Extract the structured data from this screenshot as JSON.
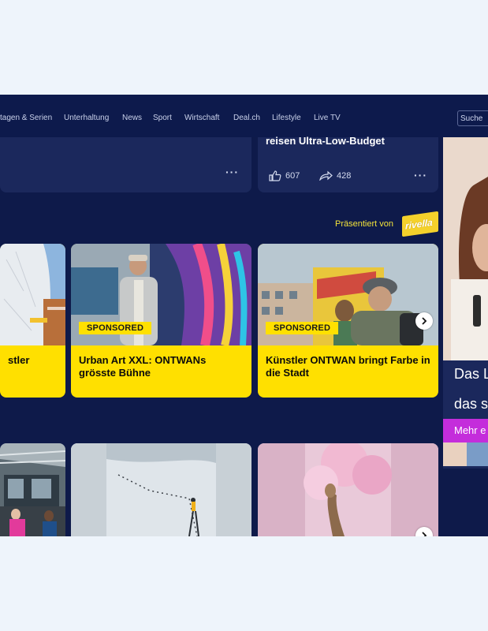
{
  "nav": {
    "items": [
      "tagen & Serien",
      "Unterhaltung",
      "News",
      "Sport",
      "Wirtschaft",
      "Deal.ch",
      "Lifestyle",
      "Live TV"
    ],
    "search_placeholder": "Suche"
  },
  "top_cards": [
    {
      "title": "",
      "more_label": "···"
    },
    {
      "title": "reisen Ultra-Low-Budget",
      "likes": "607",
      "shares": "428",
      "more_label": "···"
    }
  ],
  "presented": {
    "label": "Präsentiert von",
    "sponsor_logo_text": "rivella"
  },
  "sponsored_cards": [
    {
      "badge": "SPONSORED",
      "title": "stler"
    },
    {
      "badge": "SPONSORED",
      "title": "Urban Art XXL: ONTWANs grösste Bühne"
    },
    {
      "badge": "SPONSORED",
      "title": "Künstler ONTWAN bringt Farbe in die Stadt"
    }
  ],
  "ad": {
    "line1": "Das L",
    "line2": "das s",
    "button": "Mehr e"
  },
  "colors": {
    "brand_bg": "#0e1a4a",
    "card_bg": "#1b285c",
    "sponsored_yellow": "#ffe000",
    "ad_button": "#c42ddb"
  },
  "icons": {
    "like": "thumbs-up-icon",
    "share": "share-arrow-icon",
    "more": "more-dots-icon",
    "next": "chevron-right-icon"
  }
}
